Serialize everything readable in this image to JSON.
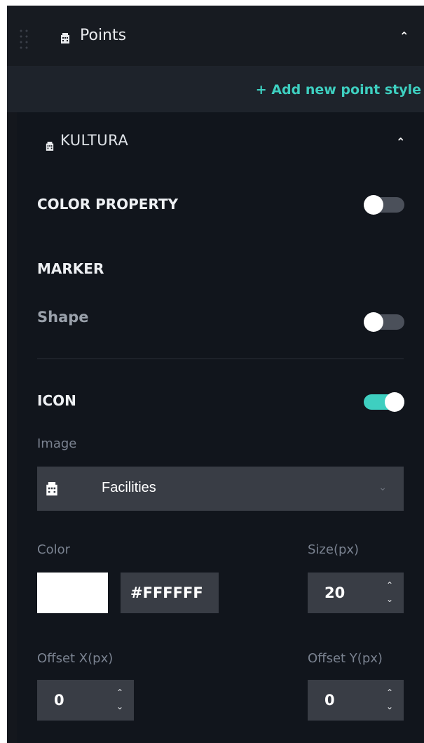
{
  "points": {
    "title": "Points",
    "add_link": "+ Add new point style"
  },
  "style": {
    "name": "KULTURA",
    "color_property": {
      "label": "COLOR PROPERTY",
      "enabled": false
    },
    "marker": {
      "label": "MARKER",
      "shape_label": "Shape",
      "shape_enabled": false
    },
    "icon": {
      "label": "ICON",
      "enabled": true,
      "image_label": "Image",
      "image_value": "Facilities",
      "color_label": "Color",
      "color_value": "#FFFFFF",
      "size_label": "Size(px)",
      "size_value": "20",
      "offset_x_label": "Offset X(px)",
      "offset_x_value": "0",
      "offset_y_label": "Offset Y(px)",
      "offset_y_value": "0"
    }
  },
  "colors": {
    "accent": "#3ecfc0",
    "panel": "#14171d",
    "input": "#393d45"
  },
  "icons": [
    "drag-handle-icon",
    "building-icon",
    "chevron-up-icon",
    "chevron-down-icon",
    "spinner-up-icon",
    "spinner-down-icon"
  ]
}
